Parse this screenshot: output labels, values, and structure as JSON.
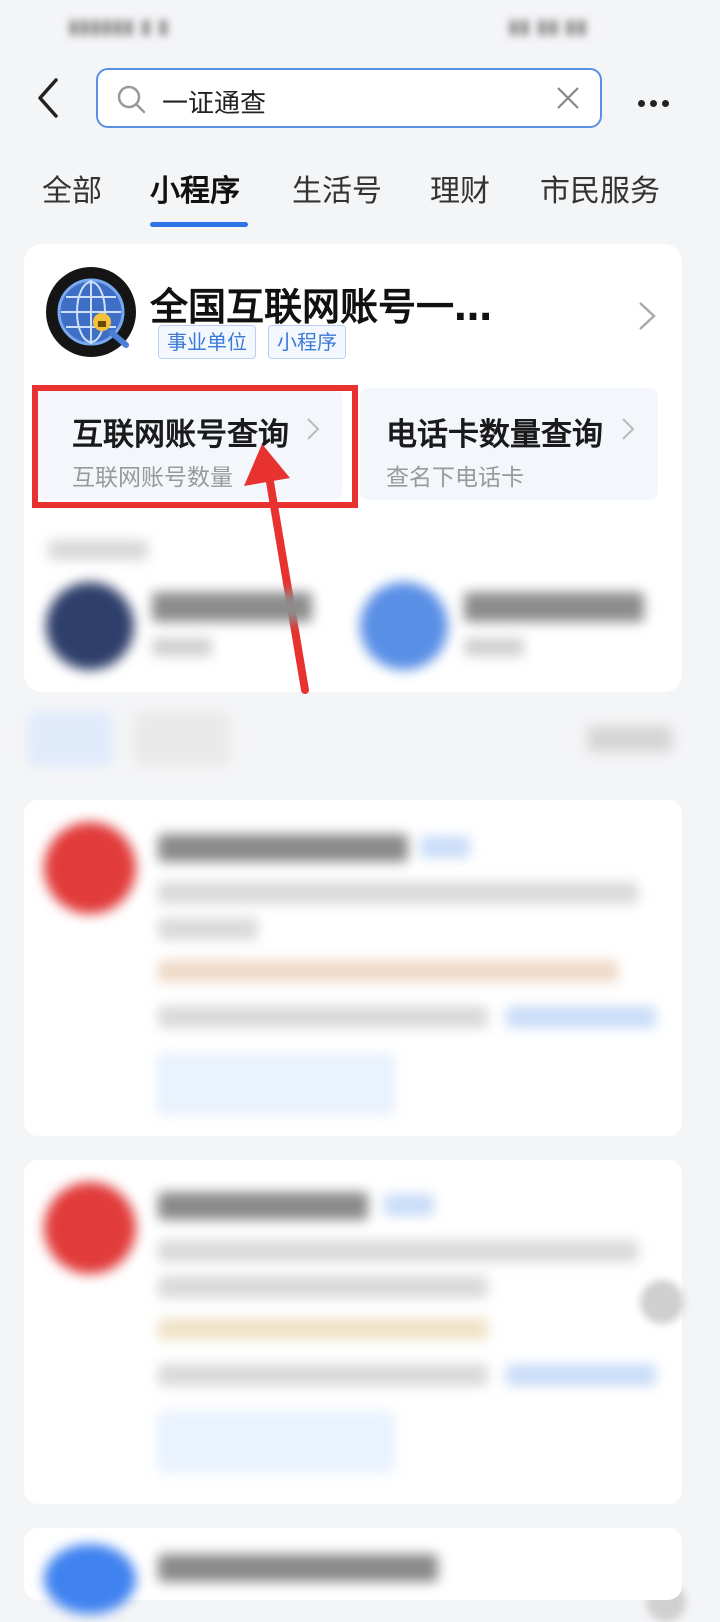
{
  "search": {
    "query": "一证通查"
  },
  "tabs": [
    {
      "label": "全部"
    },
    {
      "label": "小程序"
    },
    {
      "label": "生活号"
    },
    {
      "label": "理财"
    },
    {
      "label": "市民服务"
    }
  ],
  "result_card": {
    "title": "全国互联网账号一…",
    "tags": [
      "事业单位",
      "小程序"
    ],
    "services": [
      {
        "title": "互联网账号查询",
        "subtitle": "互联网账号数量"
      },
      {
        "title": "电话卡数量查询",
        "subtitle": "查名下电话卡"
      }
    ]
  },
  "colors": {
    "accent": "#2e74e6",
    "highlight": "#e8322f",
    "tag_text": "#3b78d8"
  },
  "icons": [
    "back-arrow-icon",
    "search-icon",
    "clear-icon",
    "more-icon",
    "chevron-right-icon",
    "globe-lock-logo-icon"
  ]
}
